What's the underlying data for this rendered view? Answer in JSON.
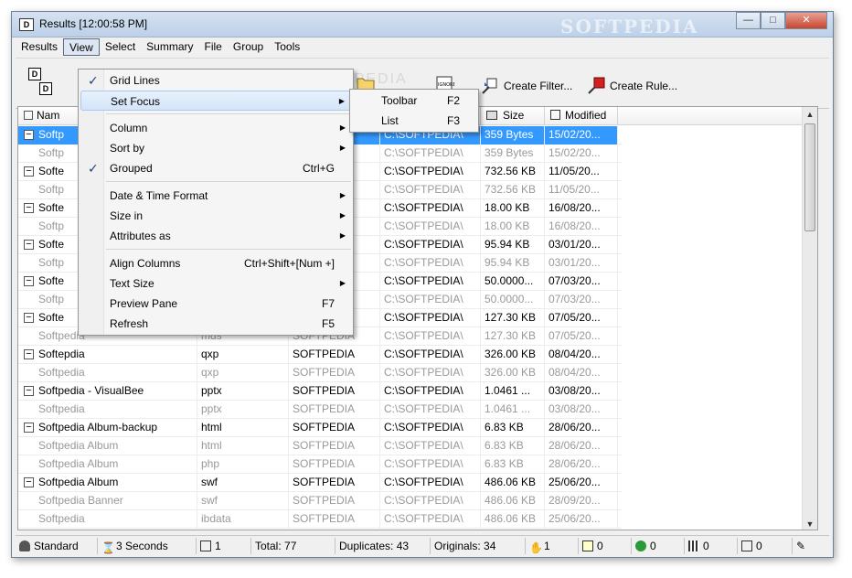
{
  "window": {
    "title": "Results [12:00:58 PM]",
    "watermark": "SOFTPEDIA"
  },
  "menubar": [
    "Results",
    "View",
    "Select",
    "Summary",
    "File",
    "Group",
    "Tools"
  ],
  "toolbar": {
    "create_filter": "Create Filter...",
    "create_rule": "Create Rule...",
    "overlay": "SOFTPEDIA"
  },
  "columns": [
    "Nam",
    "Size",
    "Modified"
  ],
  "rows": [
    {
      "name": "Softp",
      "ext": "",
      "folder": "PEDIA",
      "path": "C:\\SOFTPEDIA\\",
      "size": "359 Bytes",
      "modified": "15/02/20...",
      "expand": true,
      "dup": false
    },
    {
      "name": "Softp",
      "ext": "",
      "folder": "PEDIA",
      "path": "C:\\SOFTPEDIA\\",
      "size": "359 Bytes",
      "modified": "15/02/20...",
      "expand": false,
      "dup": true
    },
    {
      "name": "Softe",
      "ext": "",
      "folder": "PEDIA",
      "path": "C:\\SOFTPEDIA\\",
      "size": "732.56 KB",
      "modified": "11/05/20...",
      "expand": true,
      "dup": false
    },
    {
      "name": "Softp",
      "ext": "",
      "folder": "PEDIA",
      "path": "C:\\SOFTPEDIA\\",
      "size": "732.56 KB",
      "modified": "11/05/20...",
      "expand": false,
      "dup": true
    },
    {
      "name": "Softe",
      "ext": "",
      "folder": "PEDIA",
      "path": "C:\\SOFTPEDIA\\",
      "size": "18.00 KB",
      "modified": "16/08/20...",
      "expand": true,
      "dup": false
    },
    {
      "name": "Softp",
      "ext": "",
      "folder": "PEDIA",
      "path": "C:\\SOFTPEDIA\\",
      "size": "18.00 KB",
      "modified": "16/08/20...",
      "expand": false,
      "dup": true
    },
    {
      "name": "Softe",
      "ext": "",
      "folder": "PEDIA",
      "path": "C:\\SOFTPEDIA\\",
      "size": "95.94 KB",
      "modified": "03/01/20...",
      "expand": true,
      "dup": false
    },
    {
      "name": "Softp",
      "ext": "",
      "folder": "PEDIA",
      "path": "C:\\SOFTPEDIA\\",
      "size": "95.94 KB",
      "modified": "03/01/20...",
      "expand": false,
      "dup": true
    },
    {
      "name": "Softe",
      "ext": "",
      "folder": "PEDIA",
      "path": "C:\\SOFTPEDIA\\",
      "size": "50.0000...",
      "modified": "07/03/20...",
      "expand": true,
      "dup": false
    },
    {
      "name": "Softp",
      "ext": "",
      "folder": "PEDIA",
      "path": "C:\\SOFTPEDIA\\",
      "size": "50.0000...",
      "modified": "07/03/20...",
      "expand": false,
      "dup": true
    },
    {
      "name": "Softe",
      "ext": "",
      "folder": "PEDIA",
      "path": "C:\\SOFTPEDIA\\",
      "size": "127.30 KB",
      "modified": "07/05/20...",
      "expand": true,
      "dup": false
    },
    {
      "name": "Softpedia",
      "ext": "mds",
      "folder": "SOFTPEDIA",
      "path": "C:\\SOFTPEDIA\\",
      "size": "127.30 KB",
      "modified": "07/05/20...",
      "expand": false,
      "dup": true
    },
    {
      "name": "Softepdia",
      "ext": "qxp",
      "folder": "SOFTPEDIA",
      "path": "C:\\SOFTPEDIA\\",
      "size": "326.00 KB",
      "modified": "08/04/20...",
      "expand": true,
      "dup": false
    },
    {
      "name": "Softpedia",
      "ext": "qxp",
      "folder": "SOFTPEDIA",
      "path": "C:\\SOFTPEDIA\\",
      "size": "326.00 KB",
      "modified": "08/04/20...",
      "expand": false,
      "dup": true
    },
    {
      "name": "Softpedia - VisualBee",
      "ext": "pptx",
      "folder": "SOFTPEDIA",
      "path": "C:\\SOFTPEDIA\\",
      "size": "1.0461 ...",
      "modified": "03/08/20...",
      "expand": true,
      "dup": false
    },
    {
      "name": "Softpedia",
      "ext": "pptx",
      "folder": "SOFTPEDIA",
      "path": "C:\\SOFTPEDIA\\",
      "size": "1.0461 ...",
      "modified": "03/08/20...",
      "expand": false,
      "dup": true
    },
    {
      "name": "Softpedia Album-backup",
      "ext": "html",
      "folder": "SOFTPEDIA",
      "path": "C:\\SOFTPEDIA\\",
      "size": "6.83 KB",
      "modified": "28/06/20...",
      "expand": true,
      "dup": false
    },
    {
      "name": "Softpedia Album",
      "ext": "html",
      "folder": "SOFTPEDIA",
      "path": "C:\\SOFTPEDIA\\",
      "size": "6.83 KB",
      "modified": "28/06/20...",
      "expand": false,
      "dup": true
    },
    {
      "name": "Softpedia Album",
      "ext": "php",
      "folder": "SOFTPEDIA",
      "path": "C:\\SOFTPEDIA\\",
      "size": "6.83 KB",
      "modified": "28/06/20...",
      "expand": false,
      "dup": true
    },
    {
      "name": "Softpedia Album",
      "ext": "swf",
      "folder": "SOFTPEDIA",
      "path": "C:\\SOFTPEDIA\\",
      "size": "486.06 KB",
      "modified": "25/06/20...",
      "expand": true,
      "dup": false
    },
    {
      "name": "Softpedia Banner",
      "ext": "swf",
      "folder": "SOFTPEDIA",
      "path": "C:\\SOFTPEDIA\\",
      "size": "486.06 KB",
      "modified": "28/09/20...",
      "expand": false,
      "dup": true
    },
    {
      "name": "Softpedia",
      "ext": "ibdata",
      "folder": "SOFTPEDIA",
      "path": "C:\\SOFTPEDIA\\",
      "size": "486.06 KB",
      "modified": "25/06/20...",
      "expand": false,
      "dup": true
    }
  ],
  "view_menu": {
    "grid_lines": "Grid Lines",
    "set_focus": "Set Focus",
    "column": "Column",
    "sort_by": "Sort by",
    "grouped": "Grouped",
    "grouped_sc": "Ctrl+G",
    "date_time_format": "Date & Time Format",
    "size_in": "Size in",
    "attributes_as": "Attributes as",
    "align_columns": "Align Columns",
    "align_columns_sc": "Ctrl+Shift+[Num +]",
    "text_size": "Text Size",
    "preview_pane": "Preview Pane",
    "preview_pane_sc": "F7",
    "refresh": "Refresh",
    "refresh_sc": "F5"
  },
  "focus_submenu": {
    "toolbar": "Toolbar",
    "toolbar_sc": "F2",
    "list": "List",
    "list_sc": "F3"
  },
  "statusbar": {
    "standard": "Standard",
    "seconds": "3 Seconds",
    "count1": "1",
    "total": "Total: 77",
    "duplicates": "Duplicates: 43",
    "originals": "Originals: 34",
    "c1": "1",
    "c2": "0",
    "c3": "0",
    "c4": "0",
    "c5": "0"
  }
}
